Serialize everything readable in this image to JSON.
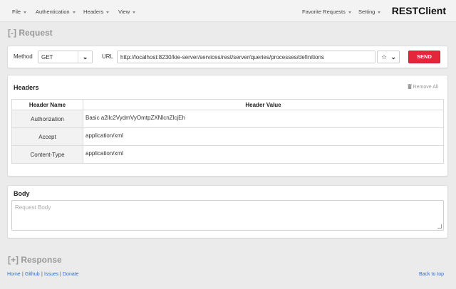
{
  "nav": {
    "file": "File",
    "authentication": "Authentication",
    "headers": "Headers",
    "view": "View",
    "favorite_requests": "Favorite Requests",
    "setting": "Setting",
    "brand": "RESTClient"
  },
  "request": {
    "section_title": "[-] Request",
    "method_label": "Method",
    "method_value": "GET",
    "url_label": "URL",
    "url_value": "http://localhost:8230/kie-server/services/rest/server/queries/processes/definitions",
    "send_label": "SEND"
  },
  "headers_panel": {
    "title": "Headers",
    "remove_all": "Remove All",
    "col_name": "Header Name",
    "col_value": "Header Value",
    "rows": [
      {
        "name": "Authorization",
        "value": "Basic a2llc2VydmVyOmtpZXNlcnZlcjEh"
      },
      {
        "name": "Accept",
        "value": "application/xml"
      },
      {
        "name": "Content-Type",
        "value": "application/xml"
      }
    ]
  },
  "body_panel": {
    "title": "Body",
    "placeholder": "Request Body"
  },
  "response": {
    "section_title": "[+] Response"
  },
  "footer": {
    "home": "Home",
    "github": "Github",
    "issues": "Issues",
    "donate": "Donate",
    "back_to_top": "Back to top",
    "sep": "|"
  },
  "colors": {
    "send": "#e3263a",
    "link": "#2a6fc9",
    "section_title": "#999999"
  }
}
